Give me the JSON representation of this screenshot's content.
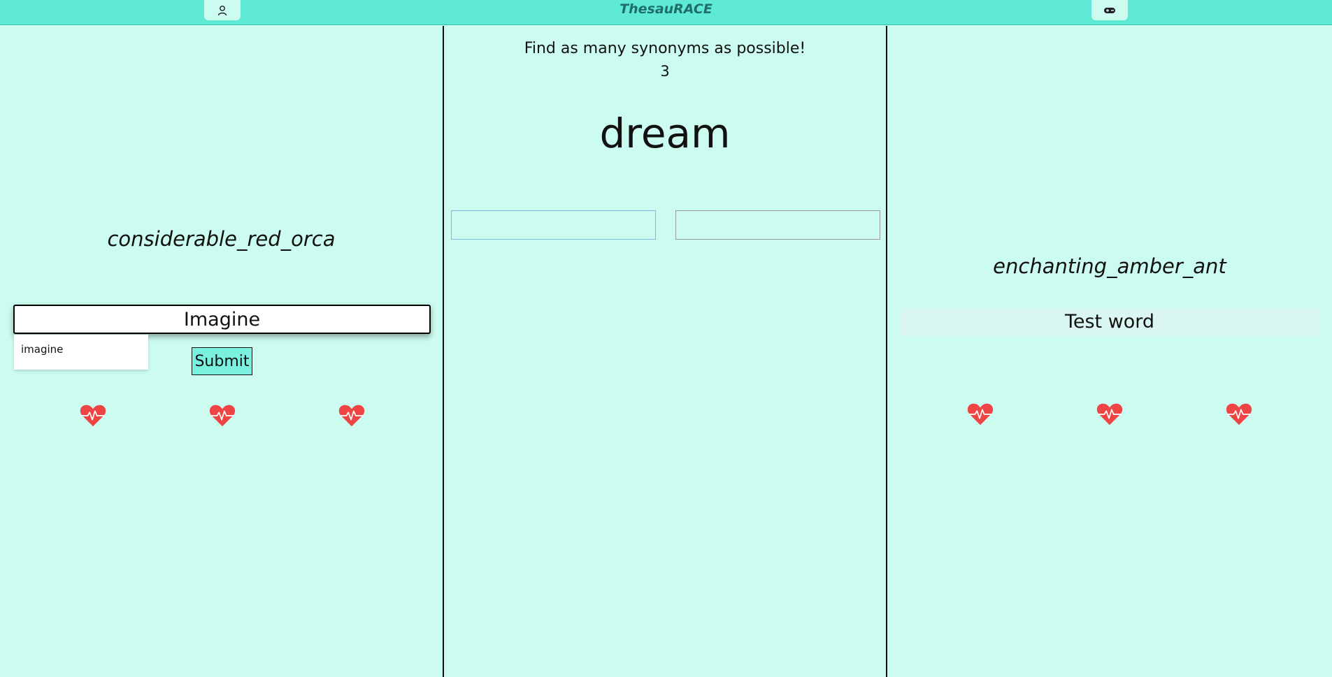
{
  "header": {
    "title": "ThesauRACE"
  },
  "player": {
    "username": "considerable_red_orca",
    "input_value": "Imagine",
    "suggestions": [
      "imagine"
    ],
    "submit_label": "Submit",
    "lives": 3
  },
  "game": {
    "instruction": "Find as many synonyms as possible!",
    "count": "3",
    "word": "dream"
  },
  "opponent": {
    "username": "enchanting_amber_ant",
    "current_word": "Test word",
    "lives": 3
  },
  "colors": {
    "background": "#ccfbef",
    "header": "#5eead4",
    "heart": "#ef4444",
    "button": "#7af0de"
  }
}
